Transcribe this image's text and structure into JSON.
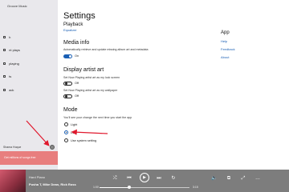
{
  "sidebar": {
    "app_title": "Groove Music",
    "items": [
      {
        "label": "h",
        "icon": "search-icon"
      },
      {
        "label": "nt plays",
        "icon": "clock-icon"
      },
      {
        "label": "playing",
        "icon": "now-playing-icon"
      },
      {
        "label": "ts",
        "icon": "list-icon"
      },
      {
        "label": "ack",
        "icon": "back-icon"
      }
    ],
    "user_name": "Shama Hoque",
    "promo_text": "Get millions of songs free",
    "promo_color": "#e87e7e"
  },
  "settings": {
    "title": "Settings",
    "playback_header": "Playback",
    "equalizer_link": "Equalizer",
    "media_info": {
      "title": "Media info",
      "description": "Automatically retrieve and update missing album art and metadata",
      "toggle_label": "On",
      "toggle_on": true
    },
    "display_artist_art": {
      "title": "Display artist art",
      "lock_screen_label": "Set Now Playing artist art as my lock screen",
      "lock_screen_toggle": "Off",
      "wallpaper_label": "Set Now Playing artist art as my wallpaper",
      "wallpaper_toggle": "Off"
    },
    "mode": {
      "title": "Mode",
      "description": "You'll see your change the next time you start the app",
      "options": [
        "Light",
        "Dark",
        "Use system setting"
      ],
      "selected": "Dark"
    }
  },
  "app_panel": {
    "heading": "App",
    "links": [
      "Help",
      "Feedback",
      "About"
    ]
  },
  "player": {
    "track_title": "Hard Piano",
    "artists": "Pusha T, Mike Dean, Rick Ross",
    "elapsed": "1:00",
    "total": "3:15",
    "progress": 0.33
  },
  "colors": {
    "accent": "#1a5fb4",
    "annotation_arrow": "#e0182d",
    "player_bar": "#7d7d7d"
  }
}
